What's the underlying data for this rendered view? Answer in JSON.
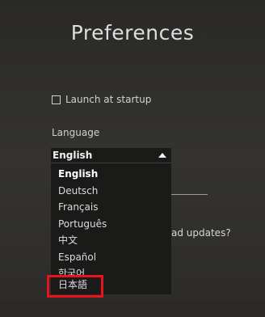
{
  "window": {
    "title": "Preferences"
  },
  "startup": {
    "label": "Launch at startup",
    "checked": false
  },
  "language": {
    "label": "Language",
    "selected": "English",
    "options": [
      "English",
      "Deutsch",
      "Français",
      "Português",
      "中文",
      "Español",
      "한국어",
      "日本語"
    ]
  },
  "background": {
    "updates_text": "ad updates?"
  },
  "colors": {
    "background": "#2f2e2c",
    "dropdown": "#1a1a19",
    "highlight": "#e8131c"
  }
}
